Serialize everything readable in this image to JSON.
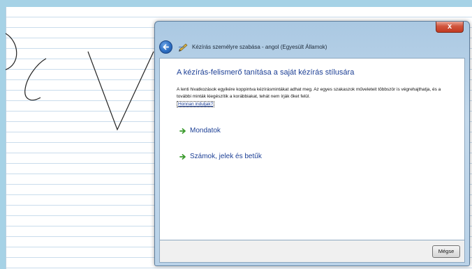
{
  "window": {
    "title": "Kézírás személyre szabása - angol (Egyesült Államok)",
    "close_label": "x"
  },
  "content": {
    "heading": "A kézírás-felismerő tanítása a saját kézírás stílusára",
    "description": "A lenti hivatkozások egyikére koppintva kézírásmintákat adhat meg. Az egyes szakaszok műveleteit többször is végrehajthatja, és a további minták kiegészítik a korábbiakat, tehát nem írják őket felül.",
    "start_link": "Honnan induljak?",
    "tasks": [
      {
        "label": "Mondatok",
        "icon": "green-arrow-icon"
      },
      {
        "label": "Számok, jelek és betűk",
        "icon": "green-arrow-icon"
      }
    ]
  },
  "footer": {
    "cancel_label": "Mégse"
  },
  "colors": {
    "link_blue": "#1c3f95",
    "desktop": "#a6d2e6",
    "paper_lines": "#c9dcec",
    "close_red": "#c23a22",
    "arrow_green": "#3a9a2c"
  }
}
